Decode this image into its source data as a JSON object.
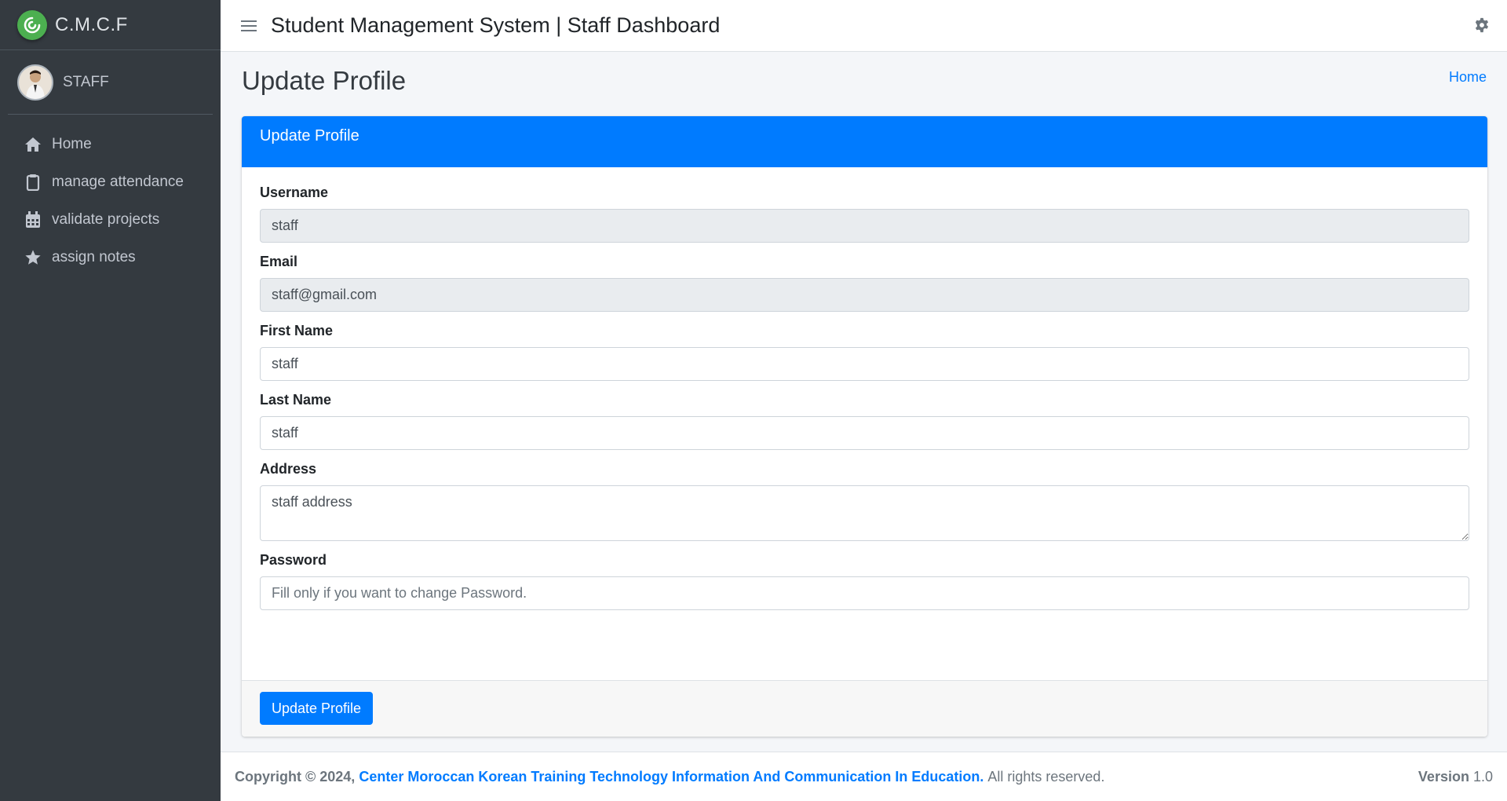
{
  "brand": {
    "name": "C.M.C.F",
    "logo_color": "#4caf50"
  },
  "user": {
    "name": "STAFF"
  },
  "sidebar": {
    "items": [
      {
        "label": "Home",
        "icon": "home-icon"
      },
      {
        "label": "manage attendance",
        "icon": "clipboard-icon"
      },
      {
        "label": "validate projects",
        "icon": "calendar-icon"
      },
      {
        "label": "assign notes",
        "icon": "star-icon"
      }
    ]
  },
  "header": {
    "title": "Student Management System | Staff Dashboard"
  },
  "page": {
    "title": "Update Profile",
    "breadcrumb": "Home"
  },
  "form": {
    "card_title": "Update Profile",
    "username": {
      "label": "Username",
      "value": "staff"
    },
    "email": {
      "label": "Email",
      "value": "staff@gmail.com"
    },
    "first_name": {
      "label": "First Name",
      "value": "staff"
    },
    "last_name": {
      "label": "Last Name",
      "value": "staff"
    },
    "address": {
      "label": "Address",
      "value": "staff address"
    },
    "password": {
      "label": "Password",
      "placeholder": "Fill only if you want to change Password."
    },
    "submit_label": "Update Profile"
  },
  "footer": {
    "copyright": "Copyright © 2024,",
    "org": "Center Moroccan Korean Training Technology Information And Communication In Education.",
    "rights": "All rights reserved.",
    "version_label": "Version",
    "version_value": "1.0"
  },
  "colors": {
    "primary": "#007bff",
    "sidebar_bg": "#343a40"
  }
}
